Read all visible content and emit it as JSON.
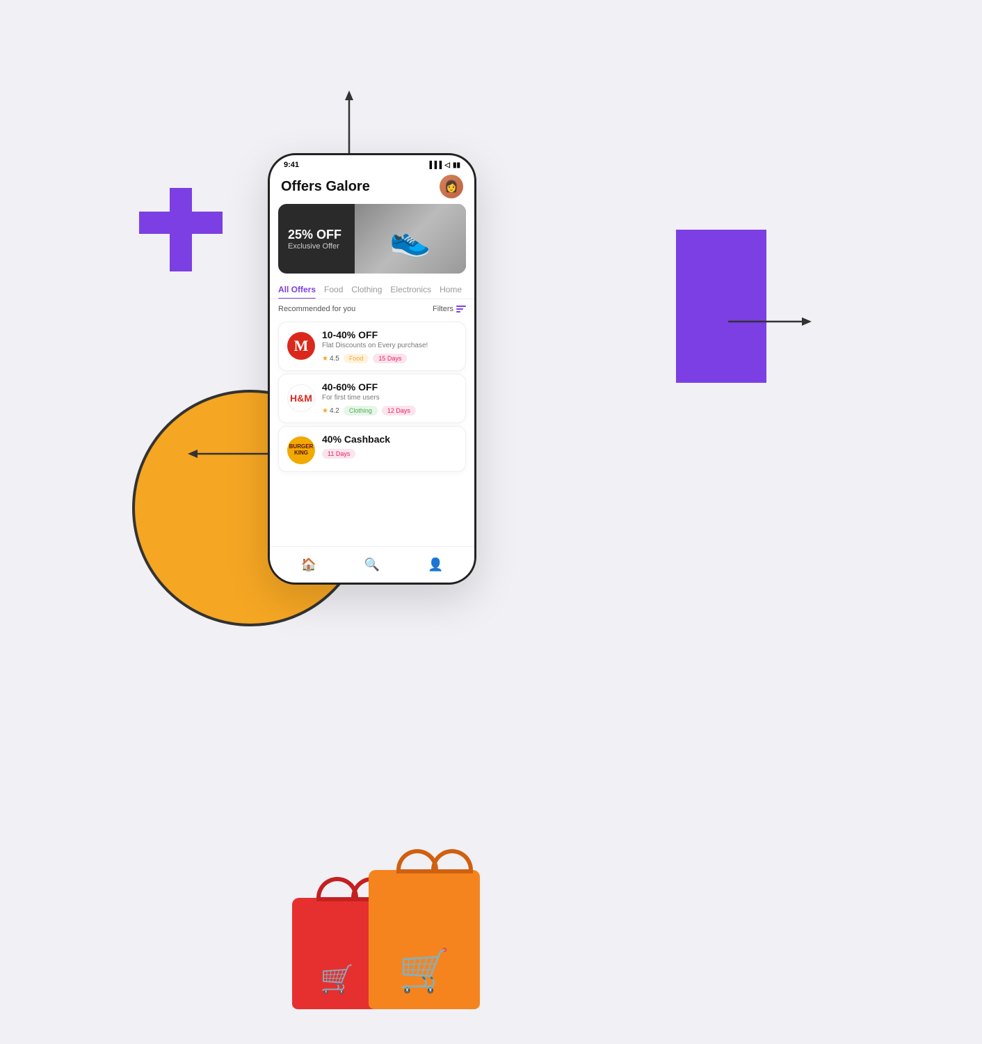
{
  "app": {
    "title": "Offers Galore",
    "time": "9:41",
    "avatar_emoji": "👩"
  },
  "decorative": {
    "plus_color": "#7B3FE4",
    "circle_color": "#f5a623",
    "rect_color": "#7B3FE4"
  },
  "banner": {
    "discount": "25% OFF",
    "subtitle": "Exclusive Offer",
    "image_emoji": "👟"
  },
  "tabs": [
    {
      "label": "All Offers",
      "active": true
    },
    {
      "label": "Food",
      "active": false
    },
    {
      "label": "Clothing",
      "active": false
    },
    {
      "label": "Electronics",
      "active": false
    },
    {
      "label": "Home",
      "active": false
    }
  ],
  "filter": {
    "recommended_label": "Recommended for you",
    "filter_label": "Filters"
  },
  "offers": [
    {
      "id": 1,
      "brand": "McDonald's",
      "brand_type": "mcdonalds",
      "brand_symbol": "M",
      "discount": "10-40% OFF",
      "description": "Flat Discounts on Every purchase!",
      "rating": "4.5",
      "category": "Food",
      "days": "15 Days"
    },
    {
      "id": 2,
      "brand": "H&M",
      "brand_type": "hm",
      "brand_symbol": "H&M",
      "discount": "40-60% OFF",
      "description": "For first time users",
      "rating": "4.2",
      "category": "Clothing",
      "days": "12 Days"
    },
    {
      "id": 3,
      "brand": "Burger King",
      "brand_type": "bk",
      "brand_symbol": "BURGER KING",
      "discount": "40% Cashback",
      "description": "",
      "rating": "",
      "category": "",
      "days": "11 Days"
    }
  ],
  "nav": {
    "items": [
      {
        "icon": "🏠",
        "label": "home",
        "active": true
      },
      {
        "icon": "🔍",
        "label": "search",
        "active": false
      },
      {
        "icon": "👤",
        "label": "profile",
        "active": false
      }
    ]
  }
}
